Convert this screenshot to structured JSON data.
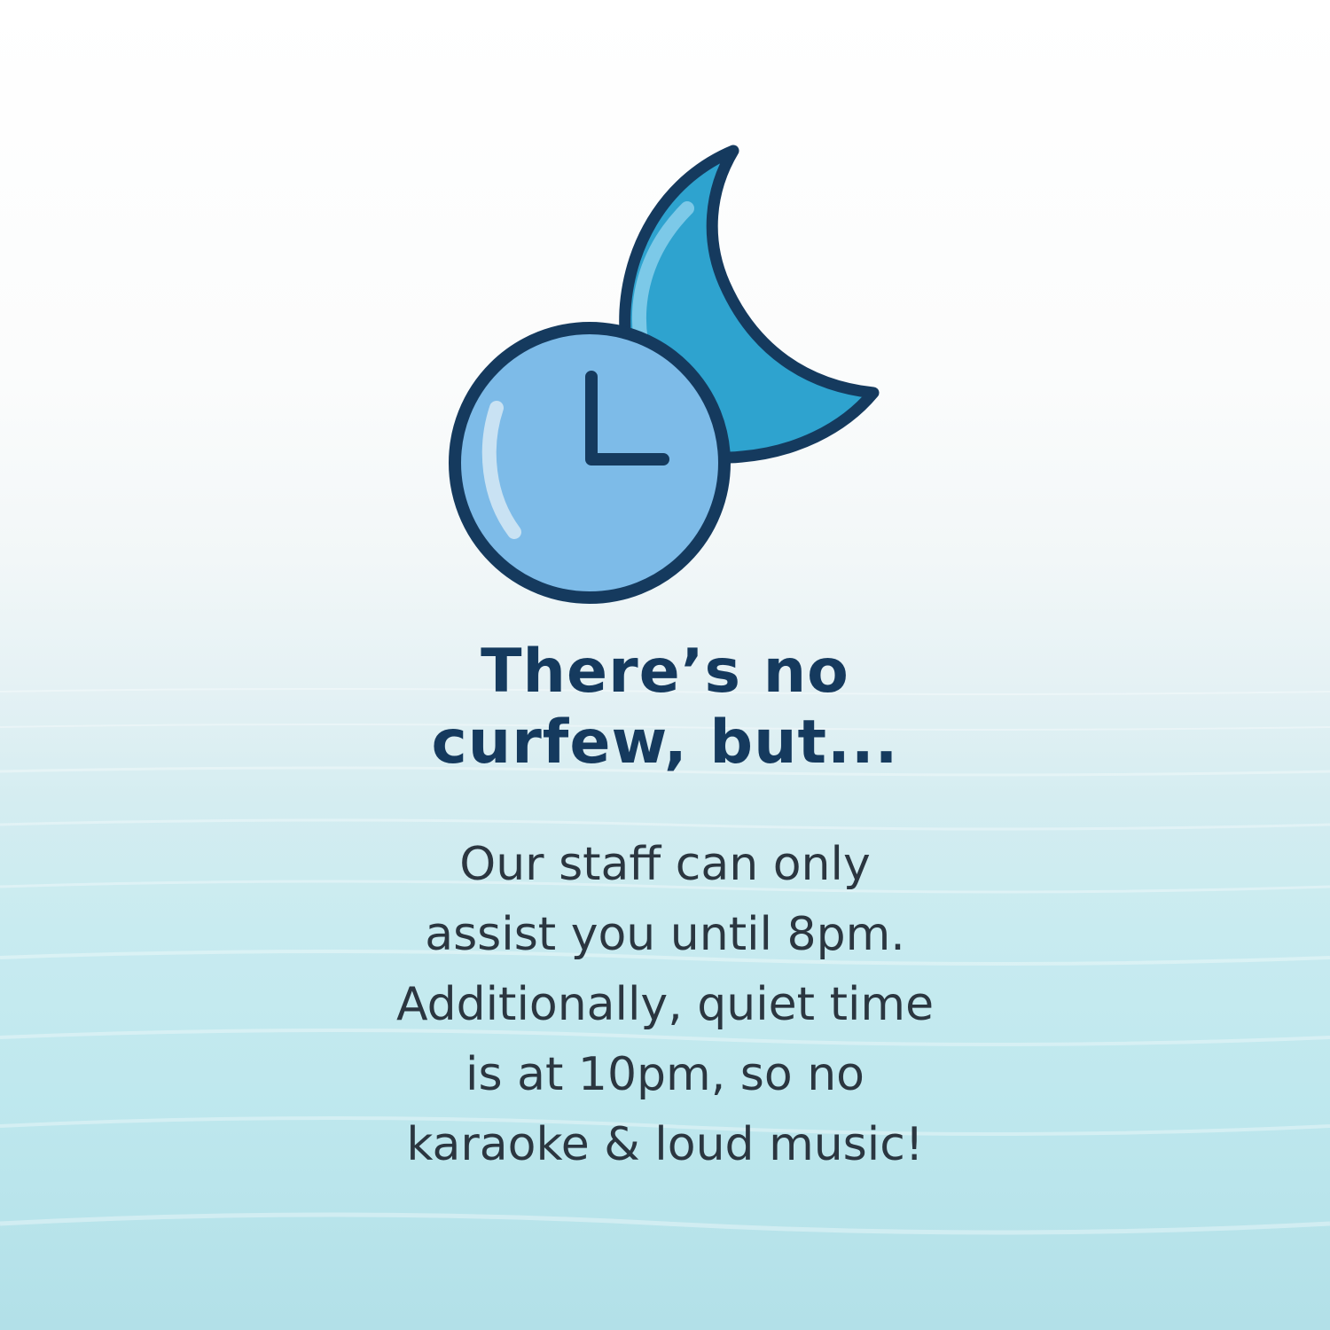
{
  "icon": {
    "name": "clock-moon-icon",
    "colors": {
      "outline": "#153a5e",
      "moon_fill": "#2ea3cf",
      "moon_highlight": "#7cc9e8",
      "clock_fill": "#7dbbe8",
      "clock_highlight": "#c9e2f3"
    }
  },
  "headline": {
    "line1": "There’s no",
    "line2": "curfew, but..."
  },
  "body": {
    "line1": "Our staff can only",
    "line2": "assist you until 8pm.",
    "line3": "Additionally, quiet time",
    "line4": "is at 10pm, so no",
    "line5": "karaoke & loud music!"
  },
  "colors": {
    "headline": "#153a5e",
    "body": "#2b3640"
  }
}
